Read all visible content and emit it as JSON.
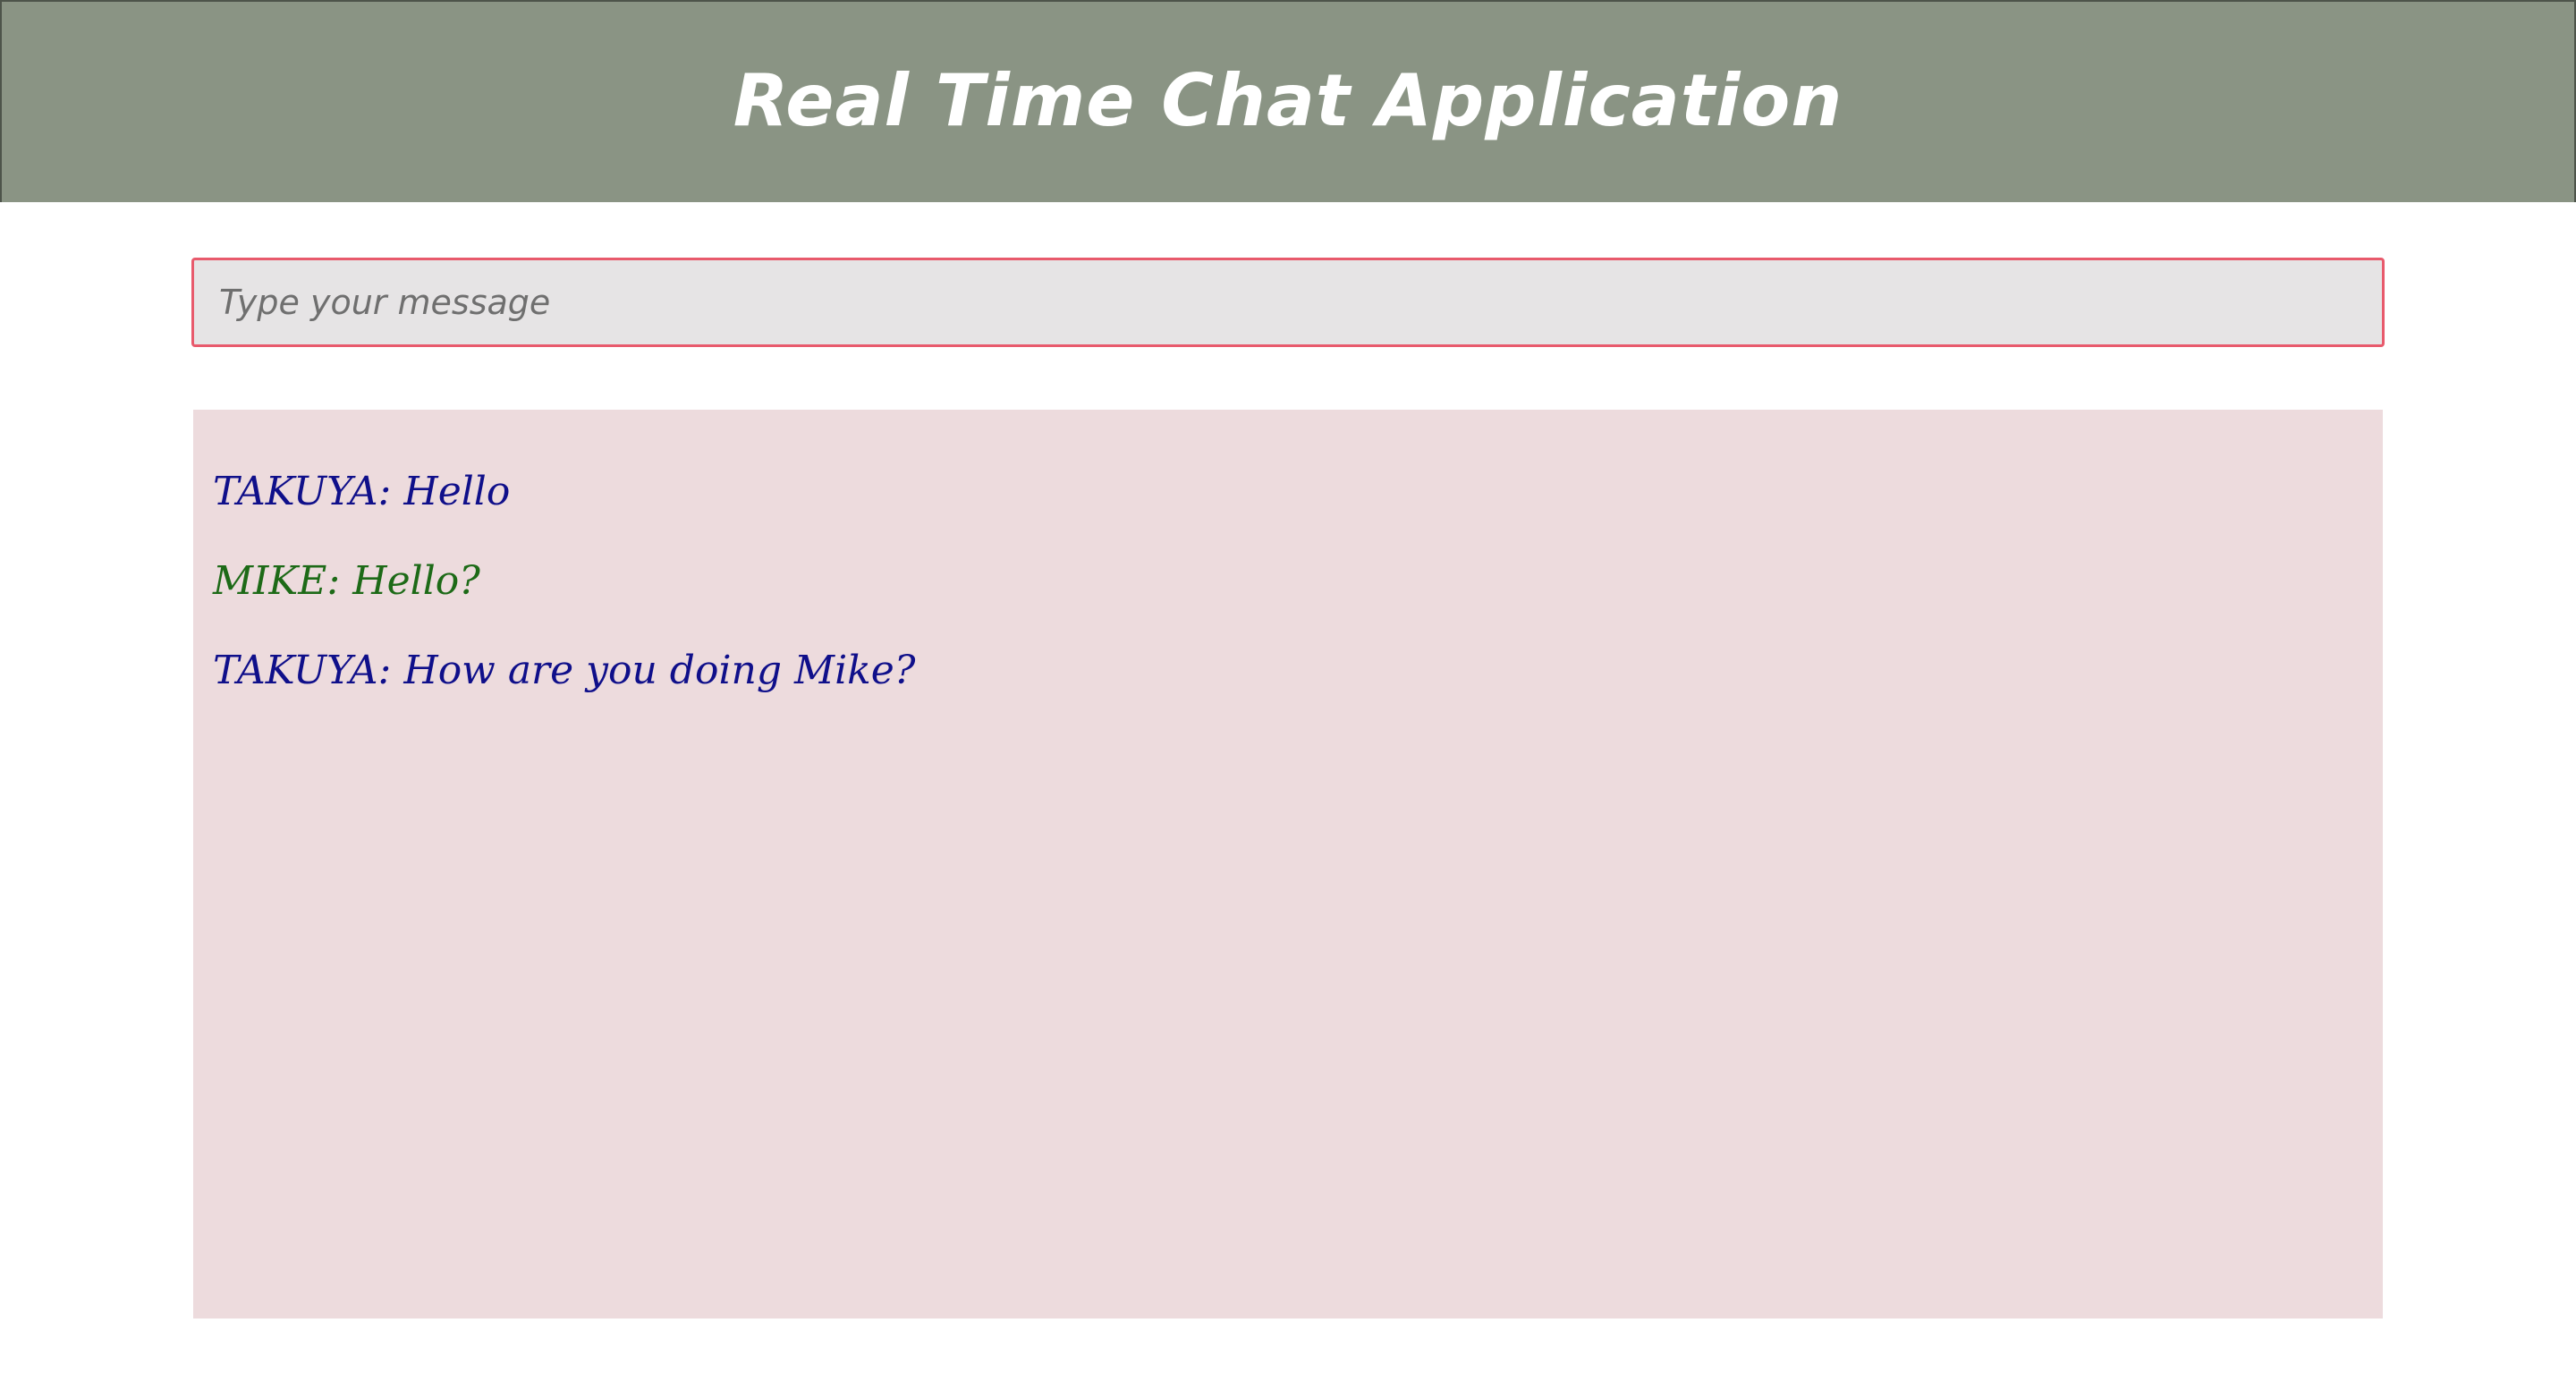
{
  "header": {
    "title": "Real Time Chat Application"
  },
  "composer": {
    "placeholder": "Type your message",
    "value": ""
  },
  "chat": {
    "messages": [
      {
        "text": "TAKUYA: Hello",
        "color": "#0f0f8a"
      },
      {
        "text": "MIKE: Hello?",
        "color": "#1d6a17"
      },
      {
        "text": "TAKUYA: How are you doing Mike?",
        "color": "#0f0f8a"
      }
    ]
  },
  "colors": {
    "header_bg": "#8a9484",
    "input_border": "#e85a6c",
    "input_bg": "#e6e4e5",
    "chat_bg": "#eddbdd"
  }
}
